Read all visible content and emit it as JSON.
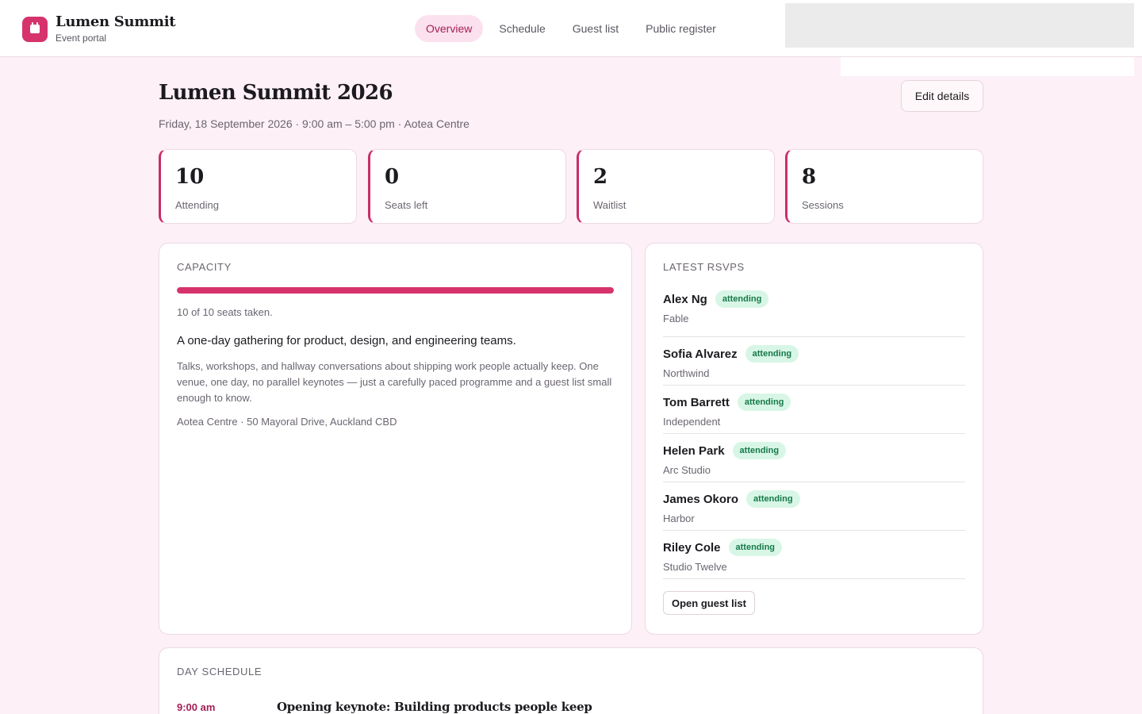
{
  "brand": {
    "name": "Lumen Summit",
    "subtitle": "Event portal",
    "color": "#d6336c"
  },
  "nav": {
    "items": [
      {
        "label": "Overview",
        "active": true
      },
      {
        "label": "Schedule",
        "active": false
      },
      {
        "label": "Guest list",
        "active": false
      },
      {
        "label": "Public register",
        "active": false
      }
    ]
  },
  "event": {
    "title": "Lumen Summit 2026",
    "subtitle": "Friday, 18 September 2026 · 9:00 am – 5:00 pm · Aotea Centre",
    "edit_label": "Edit details"
  },
  "stats": [
    {
      "value": "10",
      "label": "Attending"
    },
    {
      "value": "0",
      "label": "Seats left"
    },
    {
      "value": "2",
      "label": "Waitlist"
    },
    {
      "value": "8",
      "label": "Sessions"
    }
  ],
  "capacity": {
    "title": "CAPACITY",
    "fill_fraction": 1.0,
    "note": "10 of 10 seats taken.",
    "lead": "A one-day gathering for product, design, and engineering teams.",
    "body": "Talks, workshops, and hallway conversations about shipping work people actually keep. One venue, one day, no parallel keynotes — just a carefully paced programme and a guest list small enough to know.",
    "location": "Aotea Centre · 50 Mayoral Drive, Auckland CBD"
  },
  "rsvps": {
    "title": "LATEST RSVPS",
    "items": [
      {
        "name": "Alex Ng",
        "status": "attending",
        "org": "Fable"
      },
      {
        "name": "Sofia Alvarez",
        "status": "attending",
        "org": "Northwind"
      },
      {
        "name": "Tom Barrett",
        "status": "attending",
        "org": "Independent"
      },
      {
        "name": "Helen Park",
        "status": "attending",
        "org": "Arc Studio"
      },
      {
        "name": "James Okoro",
        "status": "attending",
        "org": "Harbor"
      },
      {
        "name": "Riley Cole",
        "status": "attending",
        "org": "Studio Twelve"
      }
    ],
    "open_label": "Open guest list"
  },
  "schedule": {
    "title": "DAY SCHEDULE",
    "items": [
      {
        "time": "9:00 am",
        "title": "Opening keynote: Building products people keep"
      }
    ]
  }
}
